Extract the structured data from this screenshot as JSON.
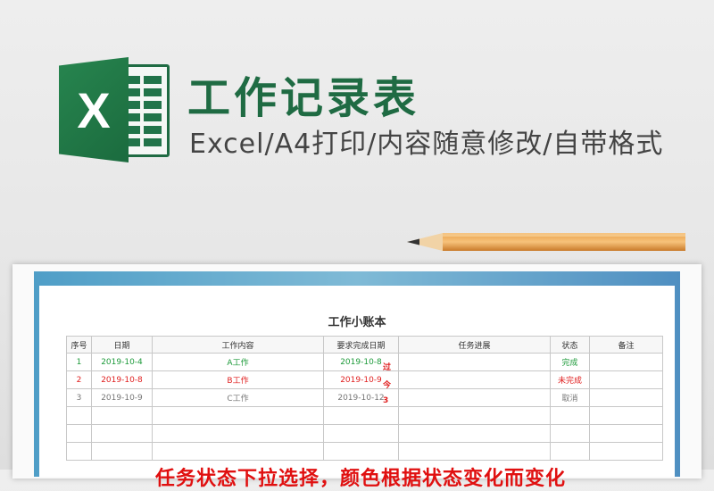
{
  "header": {
    "logo_letter": "X",
    "title": "工作记录表",
    "subtitle": "Excel/A4打印/内容随意修改/自带格式"
  },
  "sheet": {
    "title": "工作小账本",
    "columns": [
      "序号",
      "日期",
      "工作内容",
      "要求完成日期",
      "任务进展",
      "状态",
      "备注"
    ],
    "rows": [
      {
        "no": "1",
        "date": "2019-10-4",
        "content": "A工作",
        "due": "2019-10-8",
        "progress": "",
        "status": "完成",
        "note": "",
        "color": "green"
      },
      {
        "no": "2",
        "date": "2019-10-8",
        "content": "B工作",
        "due": "2019-10-9",
        "progress": "",
        "status": "未完成",
        "note": "",
        "color": "red"
      },
      {
        "no": "3",
        "date": "2019-10-9",
        "content": "C工作",
        "due": "2019-10-12",
        "progress": "",
        "status": "取消",
        "note": "",
        "color": "gray"
      }
    ],
    "empty_rows": 3,
    "overdue_marks": [
      "过",
      "今",
      "3"
    ],
    "footnote": "任务状态下拉选择，颜色根据状态变化而变化"
  },
  "colors": {
    "brand_green": "#1f6b43",
    "done": "#1d9a3a",
    "pending": "#e02020",
    "cancelled": "#777777"
  }
}
